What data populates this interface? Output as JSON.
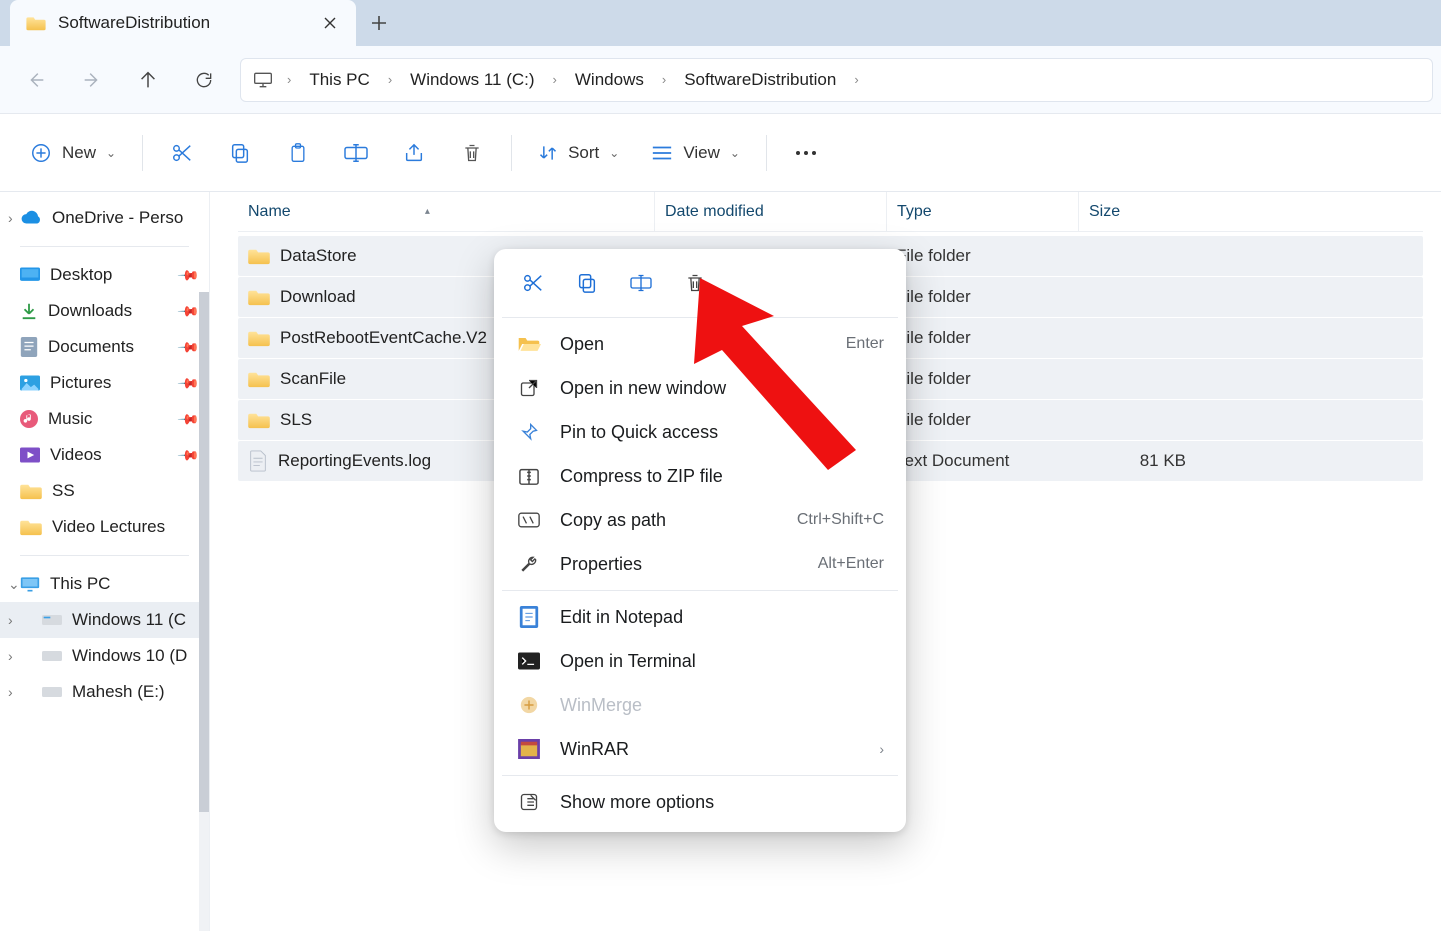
{
  "tab": {
    "title": "SoftwareDistribution"
  },
  "breadcrumb": [
    "This PC",
    "Windows 11 (C:)",
    "Windows",
    "SoftwareDistribution"
  ],
  "toolbar": {
    "new": "New",
    "sort": "Sort",
    "view": "View"
  },
  "sidebar": {
    "onedrive": "OneDrive - Perso",
    "quick": [
      {
        "label": "Desktop",
        "pin": true
      },
      {
        "label": "Downloads",
        "pin": true
      },
      {
        "label": "Documents",
        "pin": true
      },
      {
        "label": "Pictures",
        "pin": true
      },
      {
        "label": "Music",
        "pin": true
      },
      {
        "label": "Videos",
        "pin": true
      },
      {
        "label": "SS",
        "pin": false
      },
      {
        "label": "Video Lectures",
        "pin": false
      }
    ],
    "thispc": "This PC",
    "drives": [
      "Windows 11 (C",
      "Windows 10 (D",
      "Mahesh (E:)"
    ]
  },
  "columns": {
    "name": "Name",
    "date": "Date modified",
    "type": "Type",
    "size": "Size"
  },
  "rows": [
    {
      "name": "DataStore",
      "type": "File folder",
      "kind": "folder"
    },
    {
      "name": "Download",
      "type": "File folder",
      "kind": "folder"
    },
    {
      "name": "PostRebootEventCache.V2",
      "type": "File folder",
      "kind": "folder"
    },
    {
      "name": "ScanFile",
      "type": "File folder",
      "kind": "folder"
    },
    {
      "name": "SLS",
      "type": "File folder",
      "kind": "folder"
    },
    {
      "name": "ReportingEvents.log",
      "type": "Text Document",
      "size": "81 KB",
      "kind": "file"
    }
  ],
  "context_menu": {
    "open": "Open",
    "open_shortcut": "Enter",
    "open_new_window": "Open in new window",
    "pin_quick": "Pin to Quick access",
    "compress": "Compress to ZIP file",
    "copy_path": "Copy as path",
    "copy_path_shortcut": "Ctrl+Shift+C",
    "properties": "Properties",
    "properties_shortcut": "Alt+Enter",
    "edit_notepad": "Edit in Notepad",
    "open_terminal": "Open in Terminal",
    "winmerge": "WinMerge",
    "winrar": "WinRAR",
    "more": "Show more options"
  }
}
